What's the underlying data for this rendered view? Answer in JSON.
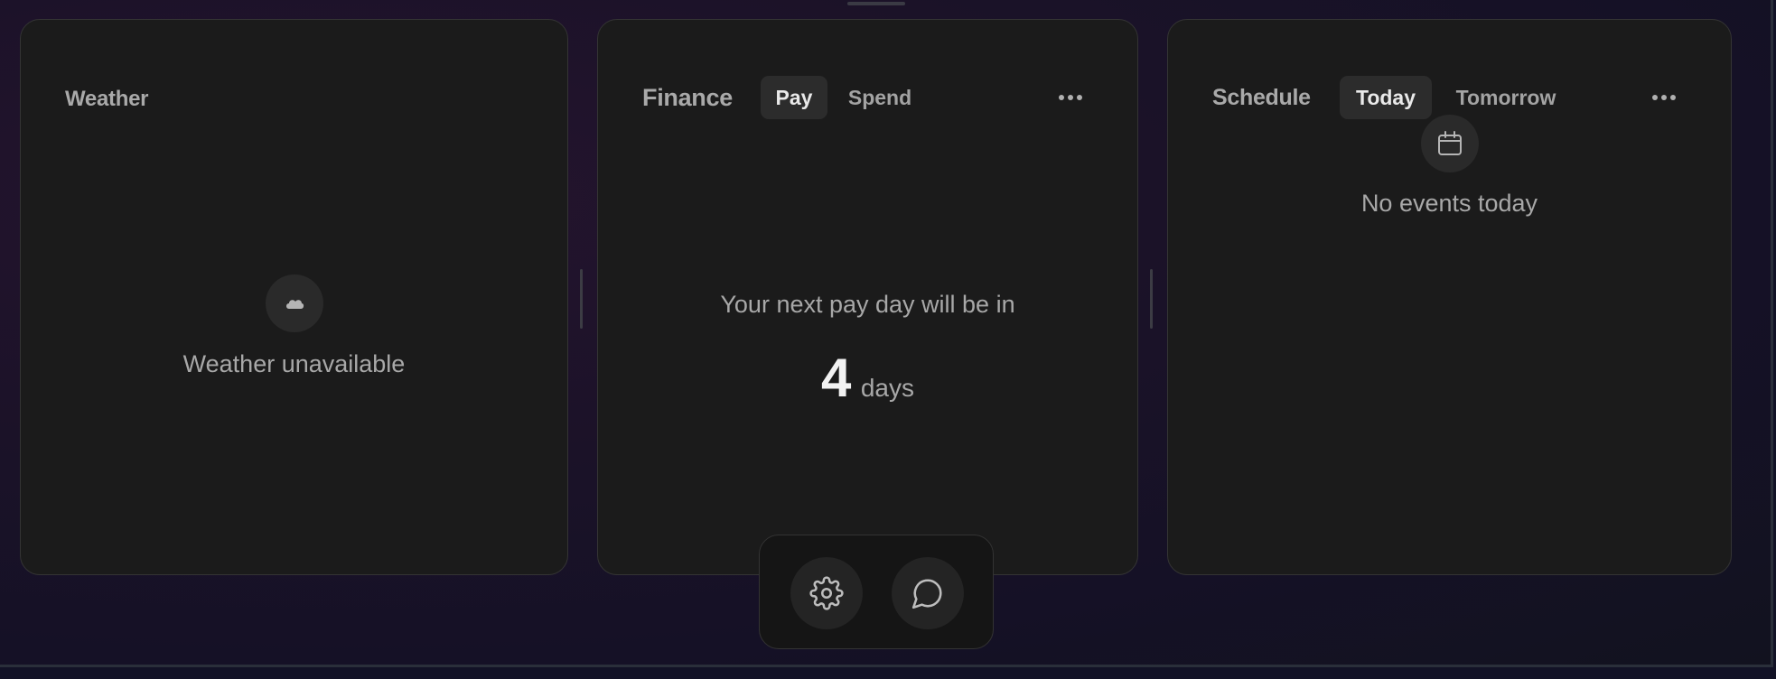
{
  "weather": {
    "title": "Weather",
    "icon": "cloud-icon",
    "status": "Weather unavailable"
  },
  "finance": {
    "title": "Finance",
    "tabs": [
      {
        "label": "Pay",
        "active": true
      },
      {
        "label": "Spend",
        "active": false
      }
    ],
    "more_icon": "more-horizontal-icon",
    "message": "Your next pay day will be in",
    "days_count": "4",
    "days_unit": "days"
  },
  "schedule": {
    "title": "Schedule",
    "tabs": [
      {
        "label": "Today",
        "active": true
      },
      {
        "label": "Tomorrow",
        "active": false
      }
    ],
    "more_icon": "more-horizontal-icon",
    "icon": "calendar-icon",
    "status": "No events today"
  },
  "dock": {
    "buttons": [
      {
        "icon": "gear-icon"
      },
      {
        "icon": "chat-bubble-icon"
      }
    ]
  },
  "colors": {
    "card_bg": "#1b1b1b",
    "active_tab_bg": "#2c2c2c",
    "text_muted": "#a8a8a8",
    "text_strong": "#f2f2f2"
  }
}
